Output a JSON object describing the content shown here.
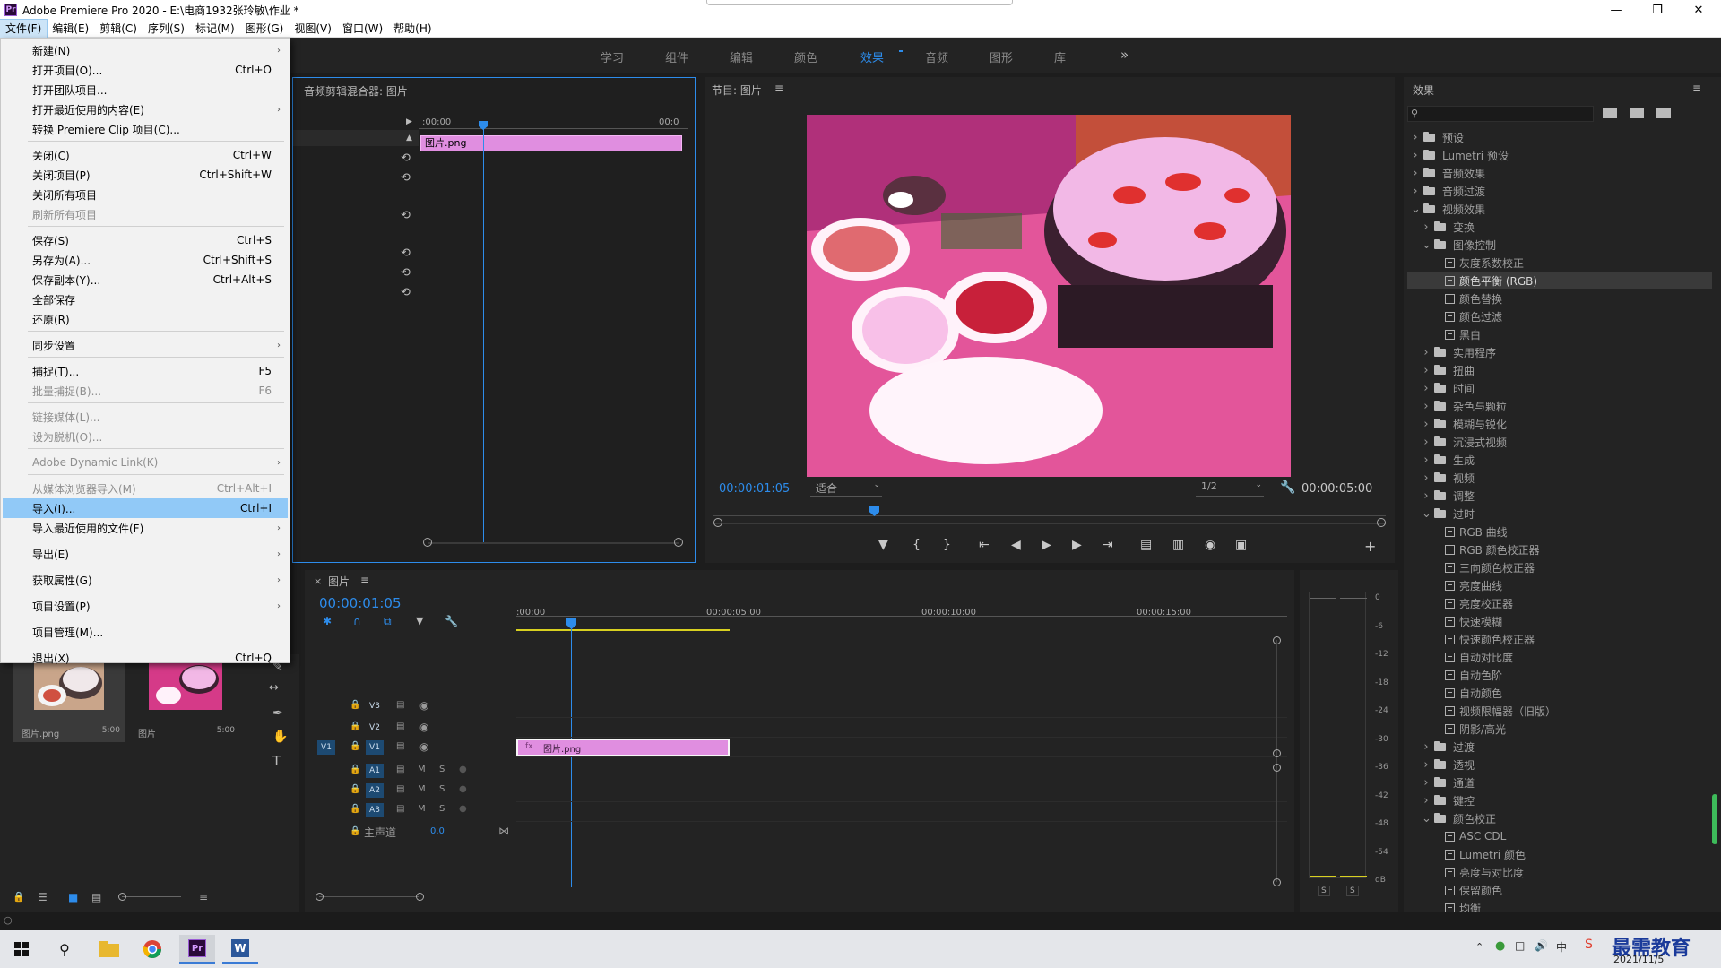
{
  "window": {
    "title": "Adobe Premiere Pro 2020 - E:\\电商1932张玲敏\\作业 *",
    "app_logo": "Pr"
  },
  "menubar": [
    "文件(F)",
    "编辑(E)",
    "剪辑(C)",
    "序列(S)",
    "标记(M)",
    "图形(G)",
    "视图(V)",
    "窗口(W)",
    "帮助(H)"
  ],
  "workspaces": [
    "学习",
    "组件",
    "编辑",
    "颜色",
    "效果",
    "音频",
    "图形",
    "库"
  ],
  "workspace_active": "效果",
  "workspace_more": "»",
  "file_menu": {
    "items": [
      {
        "label": "新建(N)",
        "shortcut": "",
        "submenu": true
      },
      {
        "label": "打开项目(O)...",
        "shortcut": "Ctrl+O"
      },
      {
        "label": "打开团队项目...",
        "shortcut": ""
      },
      {
        "label": "打开最近使用的内容(E)",
        "shortcut": "",
        "submenu": true
      },
      {
        "label": "转换 Premiere Clip 项目(C)...",
        "shortcut": ""
      },
      {
        "label": "关闭(C)",
        "shortcut": "Ctrl+W"
      },
      {
        "label": "关闭项目(P)",
        "shortcut": "Ctrl+Shift+W"
      },
      {
        "label": "关闭所有项目",
        "shortcut": ""
      },
      {
        "label": "刷新所有项目",
        "shortcut": "",
        "disabled": true
      },
      {
        "label": "保存(S)",
        "shortcut": "Ctrl+S"
      },
      {
        "label": "另存为(A)...",
        "shortcut": "Ctrl+Shift+S"
      },
      {
        "label": "保存副本(Y)...",
        "shortcut": "Ctrl+Alt+S"
      },
      {
        "label": "全部保存",
        "shortcut": ""
      },
      {
        "label": "还原(R)",
        "shortcut": ""
      },
      {
        "label": "同步设置",
        "shortcut": "",
        "submenu": true
      },
      {
        "label": "捕捉(T)...",
        "shortcut": "F5"
      },
      {
        "label": "批量捕捉(B)...",
        "shortcut": "F6",
        "disabled": true
      },
      {
        "label": "链接媒体(L)...",
        "shortcut": "",
        "disabled": true
      },
      {
        "label": "设为脱机(O)...",
        "shortcut": "",
        "disabled": true
      },
      {
        "label": "Adobe Dynamic Link(K)",
        "shortcut": "",
        "submenu": true,
        "disabled": true
      },
      {
        "label": "从媒体浏览器导入(M)",
        "shortcut": "Ctrl+Alt+I",
        "disabled": true
      },
      {
        "label": "导入(I)...",
        "shortcut": "Ctrl+I",
        "highlighted": true
      },
      {
        "label": "导入最近使用的文件(F)",
        "shortcut": "",
        "submenu": true
      },
      {
        "label": "导出(E)",
        "shortcut": "",
        "submenu": true
      },
      {
        "label": "获取属性(G)",
        "shortcut": "",
        "submenu": true
      },
      {
        "label": "项目设置(P)",
        "shortcut": "",
        "submenu": true
      },
      {
        "label": "项目管理(M)...",
        "shortcut": ""
      },
      {
        "label": "退出(X)",
        "shortcut": "Ctrl+Q"
      }
    ]
  },
  "audio_mixer": {
    "title": "音频剪辑混合器: 图片",
    "ruler_start": ":00:00",
    "ruler_end": "00:0",
    "clip_label": "图片.png"
  },
  "program": {
    "title": "节目: 图片",
    "current_time": "00:00:01:05",
    "fit": "适合",
    "resolution": "1/2",
    "duration": "00:00:05:00"
  },
  "effects": {
    "title": "效果",
    "tree": [
      {
        "label": "预设",
        "type": "folder",
        "depth": 0,
        "expanded": false,
        "star": true
      },
      {
        "label": "Lumetri 预设",
        "type": "folder",
        "depth": 0,
        "expanded": false,
        "star": true
      },
      {
        "label": "音频效果",
        "type": "folder",
        "depth": 0,
        "expanded": false
      },
      {
        "label": "音频过渡",
        "type": "folder",
        "depth": 0,
        "expanded": false
      },
      {
        "label": "视频效果",
        "type": "folder",
        "depth": 0,
        "expanded": true
      },
      {
        "label": "变换",
        "type": "folder",
        "depth": 1,
        "expanded": false
      },
      {
        "label": "图像控制",
        "type": "folder",
        "depth": 1,
        "expanded": true
      },
      {
        "label": "灰度系数校正",
        "type": "fx",
        "depth": 2
      },
      {
        "label": "颜色平衡 (RGB)",
        "type": "fx",
        "depth": 2,
        "selected": true
      },
      {
        "label": "颜色替换",
        "type": "fx",
        "depth": 2
      },
      {
        "label": "颜色过滤",
        "type": "fx",
        "depth": 2
      },
      {
        "label": "黑白",
        "type": "fx",
        "depth": 2
      },
      {
        "label": "实用程序",
        "type": "folder",
        "depth": 1,
        "expanded": false
      },
      {
        "label": "扭曲",
        "type": "folder",
        "depth": 1,
        "expanded": false
      },
      {
        "label": "时间",
        "type": "folder",
        "depth": 1,
        "expanded": false
      },
      {
        "label": "杂色与颗粒",
        "type": "folder",
        "depth": 1,
        "expanded": false
      },
      {
        "label": "模糊与锐化",
        "type": "folder",
        "depth": 1,
        "expanded": false
      },
      {
        "label": "沉浸式视频",
        "type": "folder",
        "depth": 1,
        "expanded": false
      },
      {
        "label": "生成",
        "type": "folder",
        "depth": 1,
        "expanded": false
      },
      {
        "label": "视频",
        "type": "folder",
        "depth": 1,
        "expanded": false
      },
      {
        "label": "调整",
        "type": "folder",
        "depth": 1,
        "expanded": false
      },
      {
        "label": "过时",
        "type": "folder",
        "depth": 1,
        "expanded": true
      },
      {
        "label": "RGB 曲线",
        "type": "fx",
        "depth": 2
      },
      {
        "label": "RGB 颜色校正器",
        "type": "fx",
        "depth": 2
      },
      {
        "label": "三向颜色校正器",
        "type": "fx",
        "depth": 2
      },
      {
        "label": "亮度曲线",
        "type": "fx",
        "depth": 2
      },
      {
        "label": "亮度校正器",
        "type": "fx",
        "depth": 2
      },
      {
        "label": "快速模糊",
        "type": "fx",
        "depth": 2
      },
      {
        "label": "快速颜色校正器",
        "type": "fx",
        "depth": 2
      },
      {
        "label": "自动对比度",
        "type": "fx",
        "depth": 2
      },
      {
        "label": "自动色阶",
        "type": "fx",
        "depth": 2
      },
      {
        "label": "自动颜色",
        "type": "fx",
        "depth": 2
      },
      {
        "label": "视频限幅器（旧版）",
        "type": "fx",
        "depth": 2
      },
      {
        "label": "阴影/高光",
        "type": "fx",
        "depth": 2
      },
      {
        "label": "过渡",
        "type": "folder",
        "depth": 1,
        "expanded": false
      },
      {
        "label": "透视",
        "type": "folder",
        "depth": 1,
        "expanded": false
      },
      {
        "label": "通道",
        "type": "folder",
        "depth": 1,
        "expanded": false
      },
      {
        "label": "键控",
        "type": "folder",
        "depth": 1,
        "expanded": false
      },
      {
        "label": "颜色校正",
        "type": "folder",
        "depth": 1,
        "expanded": true
      },
      {
        "label": "ASC CDL",
        "type": "fx",
        "depth": 2
      },
      {
        "label": "Lumetri 颜色",
        "type": "fx",
        "depth": 2
      },
      {
        "label": "亮度与对比度",
        "type": "fx",
        "depth": 2
      },
      {
        "label": "保留颜色",
        "type": "fx",
        "depth": 2
      },
      {
        "label": "均衡",
        "type": "fx",
        "depth": 2
      }
    ]
  },
  "timeline": {
    "tab": "图片",
    "current_time": "00:00:01:05",
    "ruler": [
      ":00:00",
      "00:00:05:00",
      "00:00:10:00",
      "00:00:15:00"
    ],
    "video_tracks": [
      "V3",
      "V2",
      "V1"
    ],
    "source_patch": "V1",
    "audio_tracks": [
      "A1",
      "A2",
      "A3"
    ],
    "mute": "M",
    "solo": "S",
    "master_label": "主声道",
    "master_value": "0.0",
    "clip_label": "图片.png",
    "clip_fx": "fx"
  },
  "project": {
    "items": [
      {
        "name": "图片.png",
        "duration": "5:00"
      },
      {
        "name": "图片",
        "duration": "5:00"
      }
    ]
  },
  "meters": {
    "scale": [
      "0",
      "-6",
      "-12",
      "-18",
      "-24",
      "-30",
      "-36",
      "-42",
      "-48",
      "-54",
      "dB"
    ],
    "solo_left": "S",
    "solo_right": "S"
  },
  "taskbar": {
    "date": "2021/11/5",
    "watermark": "最需教育",
    "ime": "中"
  }
}
